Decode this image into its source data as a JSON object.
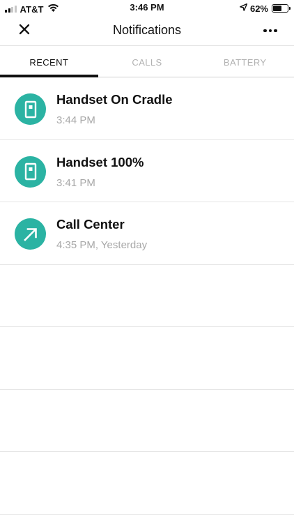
{
  "status_bar": {
    "carrier": "AT&T",
    "time": "3:46 PM",
    "battery_percent": "62%",
    "battery_level": 0.62,
    "icons": [
      "signal-icon",
      "wifi-icon",
      "location-arrow-icon",
      "battery-icon"
    ]
  },
  "header": {
    "title": "Notifications",
    "close_icon": "close-icon",
    "more_icon": "more-icon"
  },
  "tabs": [
    {
      "label": "RECENT",
      "active": true
    },
    {
      "label": "CALLS",
      "active": false
    },
    {
      "label": "BATTERY",
      "active": false
    }
  ],
  "notifications": [
    {
      "title": "Handset On Cradle",
      "time": "3:44 PM",
      "icon": "handset-icon"
    },
    {
      "title": "Handset 100%",
      "time": "3:41 PM",
      "icon": "handset-icon"
    },
    {
      "title": "Call Center",
      "time": "4:35 PM, Yesterday",
      "icon": "outgoing-call-arrow-icon"
    }
  ],
  "colors": {
    "accent": "#2bb3a3",
    "text_primary": "#111111",
    "text_secondary": "#a8a8a8",
    "tab_inactive": "#b2b2b2",
    "divider": "#e6e6e6"
  }
}
